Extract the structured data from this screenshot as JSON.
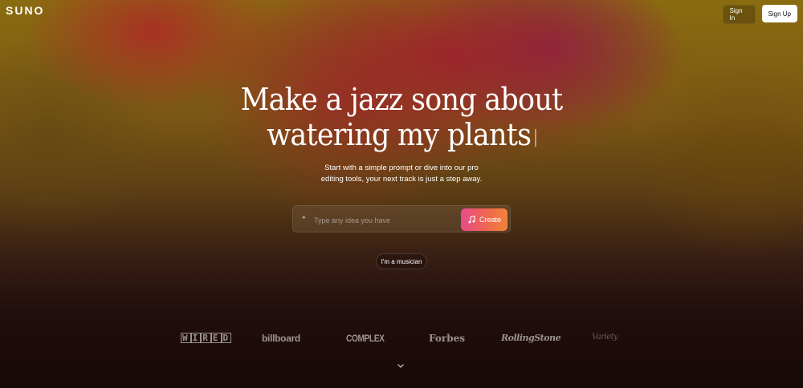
{
  "brand": {
    "logo": "SUNO"
  },
  "nav": {
    "signin_label": "Sign In",
    "signup_label": "Sign Up"
  },
  "hero": {
    "line1": "Make a jazz song about",
    "line2": "watering my plants"
  },
  "subtitle": {
    "line1": "Start with a simple prompt or dive into our pro",
    "line2": "editing tools, your next track is just a step away."
  },
  "prompt": {
    "placeholder": "Type any idea you have",
    "create_label": "Create"
  },
  "musician_label": "I'm a musician",
  "press_logos": [
    "WIRED",
    "billboard",
    "COMPLEX",
    "Forbes",
    "RollingStone",
    "Variety"
  ],
  "icons": {
    "sparkle": "sparkle-icon",
    "create": "music-note-icon",
    "scroll": "chevron-down-icon"
  },
  "colors": {
    "create_gradient_start": "#e84a8a",
    "create_gradient_end": "#f2833a",
    "signup_bg": "#ffffff"
  }
}
